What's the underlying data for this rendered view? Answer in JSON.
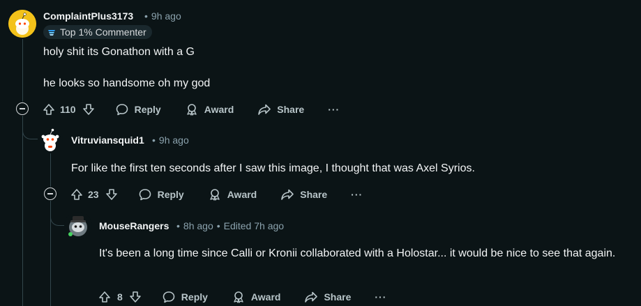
{
  "comments": [
    {
      "username": "ComplaintPlus3173",
      "time": "9h ago",
      "badge": "Top 1% Commenter",
      "body": [
        "holy shit its Gonathon with a G",
        "he looks so handsome oh my god"
      ],
      "votes": "110"
    },
    {
      "username": "Vitruviansquid1",
      "time": "9h ago",
      "body": [
        "For like the first ten seconds after I saw this image, I thought that was Axel Syrios."
      ],
      "votes": "23"
    },
    {
      "username": "MouseRangers",
      "time": "8h ago",
      "edited": "Edited 7h ago",
      "body": [
        "It's been a long time since Calli or Kronii collaborated with a Holostar... it would be nice to see that again."
      ],
      "votes": "8"
    }
  ],
  "actions": {
    "reply": "Reply",
    "award": "Award",
    "share": "Share",
    "more": "···"
  },
  "colors": {
    "background": "#0b1416",
    "text": "#f2f4f5",
    "meta": "#8ba2ad",
    "action": "#b8c5c9",
    "thread_line": "#33464c"
  }
}
